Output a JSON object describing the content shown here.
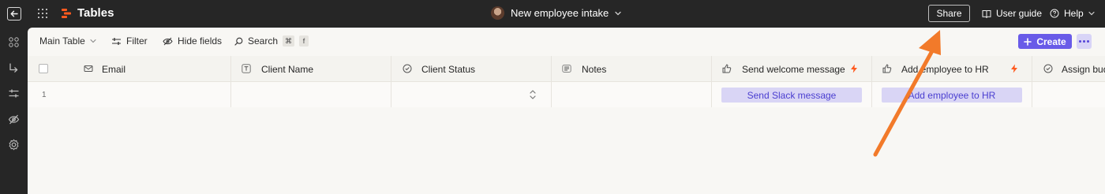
{
  "app": {
    "name": "Tables",
    "document_title": "New employee intake",
    "share_label": "Share",
    "user_guide_label": "User guide",
    "help_label": "Help"
  },
  "toolbar": {
    "view_label": "Main Table",
    "filter_label": "Filter",
    "hide_fields_label": "Hide fields",
    "search_label": "Search",
    "search_kbd_symbol": "⌘",
    "search_kbd_key": "f",
    "create_label": "Create"
  },
  "table": {
    "columns": [
      {
        "label": "Email",
        "icon": "envelope-icon"
      },
      {
        "label": "Client Name",
        "icon": "text-field-icon"
      },
      {
        "label": "Client Status",
        "icon": "status-circle-icon"
      },
      {
        "label": "Notes",
        "icon": "long-text-icon"
      },
      {
        "label": "Send welcome message",
        "icon": "thumbs-up-icon",
        "automation": true
      },
      {
        "label": "Add employee to HR",
        "icon": "thumbs-up-icon",
        "automation": true
      },
      {
        "label": "Assign bud",
        "icon": "status-circle-icon"
      }
    ],
    "rows": [
      {
        "number": "1",
        "send_button": "Send Slack message",
        "add_button": "Add employee to HR"
      }
    ]
  },
  "colors": {
    "topbar": "#262626",
    "accent": "#695be8",
    "accent_light": "#d9d5f5",
    "annotation_arrow": "#f27a2a",
    "brand": "#ff5a1f"
  }
}
